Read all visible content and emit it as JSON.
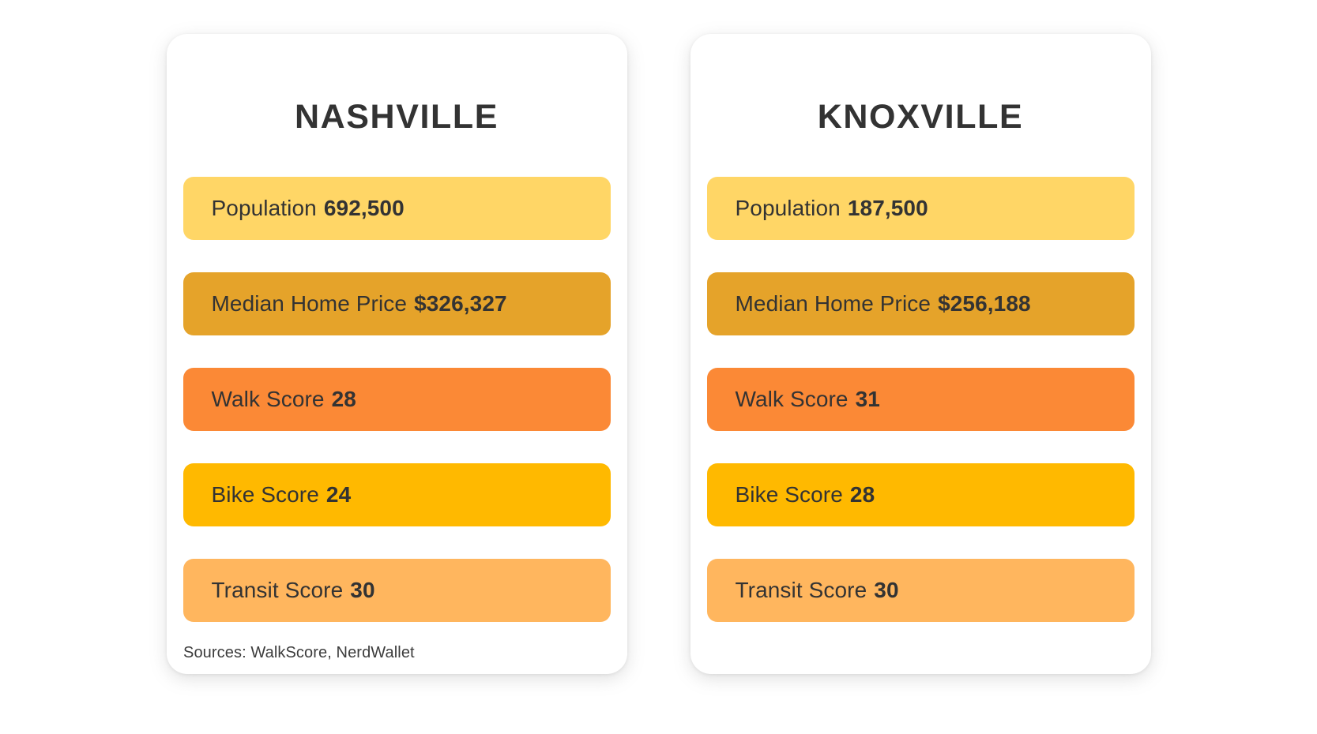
{
  "footnote": {
    "sources": "Sources: WalkScore, NerdWallet"
  },
  "palette": {
    "population": "#FFD666",
    "median_home_price": "#E5A32A",
    "walk_score": "#FB8936",
    "bike_score": "#FFB900",
    "transit_score": "#FFB65E",
    "card_background": "#FFFFFF",
    "page_background": "#FFFFFF",
    "text": "#333333"
  },
  "cards": [
    {
      "title": "NASHVILLE",
      "rows": [
        {
          "label": "Population",
          "value": "692,500",
          "color": "#FFD666",
          "metric": "population"
        },
        {
          "label": "Median Home Price",
          "value": "$326,327",
          "color": "#E5A32A",
          "metric": "median-home-price"
        },
        {
          "label": "Walk Score",
          "value": "28",
          "color": "#FB8936",
          "metric": "walk-score"
        },
        {
          "label": "Bike Score",
          "value": "24",
          "color": "#FFB900",
          "metric": "bike-score"
        },
        {
          "label": "Transit Score",
          "value": "30",
          "color": "#FFB65E",
          "metric": "transit-score"
        }
      ]
    },
    {
      "title": "KNOXVILLE",
      "rows": [
        {
          "label": "Population",
          "value": "187,500",
          "color": "#FFD666",
          "metric": "population"
        },
        {
          "label": "Median Home Price",
          "value": "$256,188",
          "color": "#E5A32A",
          "metric": "median-home-price"
        },
        {
          "label": "Walk Score",
          "value": "31",
          "color": "#FB8936",
          "metric": "walk-score"
        },
        {
          "label": "Bike Score",
          "value": "28",
          "color": "#FFB900",
          "metric": "bike-score"
        },
        {
          "label": "Transit Score",
          "value": "30",
          "color": "#FFB65E",
          "metric": "transit-score"
        }
      ]
    }
  ],
  "chart_data": {
    "type": "table",
    "title": "",
    "categories": [
      "Population",
      "Median Home Price",
      "Walk Score",
      "Bike Score",
      "Transit Score"
    ],
    "series": [
      {
        "name": "Nashville",
        "values": [
          692500,
          326327,
          28,
          24,
          30
        ]
      },
      {
        "name": "Knoxville",
        "values": [
          187500,
          256188,
          31,
          28,
          30
        ]
      }
    ],
    "display_values": [
      {
        "name": "Nashville",
        "values": [
          "692,500",
          "$326,327",
          "28",
          "24",
          "30"
        ]
      },
      {
        "name": "Knoxville",
        "values": [
          "187,500",
          "$256,188",
          "31",
          "28",
          "30"
        ]
      }
    ],
    "row_colors": [
      "#FFD666",
      "#E5A32A",
      "#FB8936",
      "#FFB900",
      "#FFB65E"
    ],
    "xlabel": "",
    "ylabel": "",
    "legend": [
      "Nashville",
      "Knoxville"
    ],
    "legend_position": "top",
    "grid": false,
    "annotations": [
      "Sources: WalkScore, NerdWallet"
    ]
  }
}
